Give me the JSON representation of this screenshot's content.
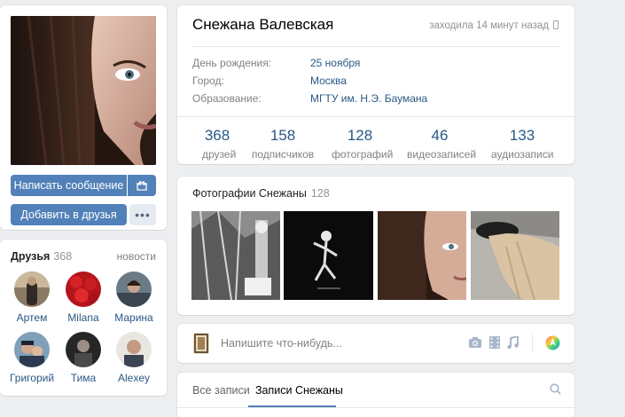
{
  "profile": {
    "name": "Снежана Валевская",
    "last_seen": "заходила 14 минут назад",
    "info": [
      {
        "label": "День рождения:",
        "value": "25 ноября"
      },
      {
        "label": "Город:",
        "value": "Москва"
      },
      {
        "label": "Образование:",
        "value": "МГТУ им. Н.Э. Баумана"
      }
    ],
    "counters": [
      {
        "num": "368",
        "label": "друзей"
      },
      {
        "num": "158",
        "label": "подписчиков"
      },
      {
        "num": "128",
        "label": "фотографий"
      },
      {
        "num": "46",
        "label": "видеозаписей"
      },
      {
        "num": "133",
        "label": "аудиозаписи"
      }
    ]
  },
  "actions": {
    "message_label": "Написать сообщение",
    "add_friend_label": "Добавить в друзья",
    "more_label": "•••"
  },
  "friends": {
    "title": "Друзья",
    "count": "368",
    "news_link": "новости",
    "items": [
      {
        "name": "Артем"
      },
      {
        "name": "Milana"
      },
      {
        "name": "Марина"
      },
      {
        "name": "Григорий"
      },
      {
        "name": "Тима"
      },
      {
        "name": "Alexey"
      }
    ]
  },
  "photos": {
    "title": "Фотографии Снежаны",
    "count": "128"
  },
  "post": {
    "placeholder": "Напишите что-нибудь..."
  },
  "wall": {
    "tab_all": "Все записи",
    "tab_own": "Записи Снежаны"
  },
  "colors": {
    "accent": "#5181b8",
    "link": "#2a5885",
    "background": "#edeef0"
  },
  "icons": [
    "gift-icon",
    "phone-icon",
    "camera-icon",
    "video-icon",
    "music-icon",
    "color-wheel-icon",
    "search-icon"
  ]
}
